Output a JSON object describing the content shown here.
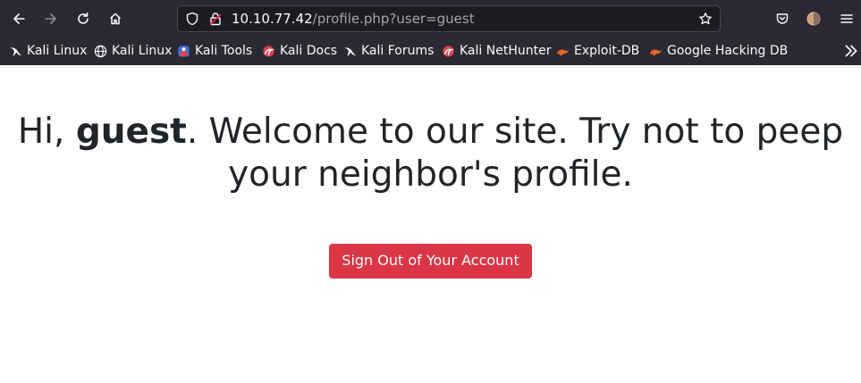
{
  "browser": {
    "url_host": "10.10.77.42",
    "url_path": "/profile.php?user=guest",
    "bookmarks": [
      {
        "label": "Kali Linux",
        "icon": "kali-dragon-icon"
      },
      {
        "label": "Kali Linux",
        "icon": "globe-icon"
      },
      {
        "label": "Kali Tools",
        "icon": "kali-tools-icon"
      },
      {
        "label": "Kali Docs",
        "icon": "kali-red-icon"
      },
      {
        "label": "Kali Forums",
        "icon": "kali-dragon-icon"
      },
      {
        "label": "Kali NetHunter",
        "icon": "kali-red-icon"
      },
      {
        "label": "Exploit-DB",
        "icon": "exploit-db-icon"
      },
      {
        "label": "Google Hacking DB",
        "icon": "exploit-db-icon"
      }
    ]
  },
  "page": {
    "greeting_prefix": "Hi, ",
    "username": "guest",
    "greeting_suffix": ". Welcome to our site. Try not to peep",
    "greeting_line2": "your neighbor's profile.",
    "signout_label": "Sign Out of Your Account"
  },
  "colors": {
    "toolbar_bg": "#2b2a33",
    "button_red": "#dc3545",
    "heading": "#212529"
  }
}
